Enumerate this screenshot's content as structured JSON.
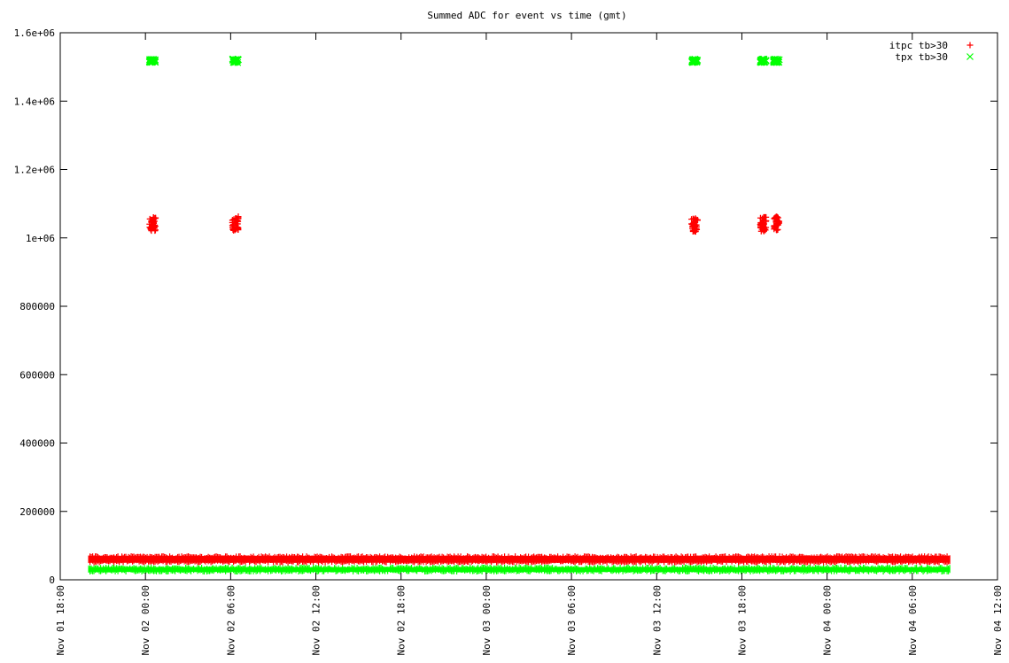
{
  "chart_data": {
    "type": "scatter",
    "title": "Summed ADC for event vs time (gmt)",
    "xlabel": "",
    "ylabel": "",
    "x_ticks": [
      "Nov 01 18:00",
      "Nov 02 00:00",
      "Nov 02 06:00",
      "Nov 02 12:00",
      "Nov 02 18:00",
      "Nov 03 00:00",
      "Nov 03 06:00",
      "Nov 03 12:00",
      "Nov 03 18:00",
      "Nov 04 00:00",
      "Nov 04 06:00",
      "Nov 04 12:00"
    ],
    "xlim": [
      "Nov 01 18:00",
      "Nov 04 12:00"
    ],
    "y_ticks": [
      "0",
      "200000",
      "400000",
      "600000",
      "800000",
      "1e+06",
      "1.2e+06",
      "1.4e+06",
      "1.6e+06"
    ],
    "ylim": [
      0,
      1600000
    ],
    "grid": false,
    "legend_position": "top-right",
    "series": [
      {
        "name": "itpc tb>30",
        "color": "#ff0000",
        "marker": "plus",
        "band": {
          "x_start": "Nov 01 20:00",
          "x_end": "Nov 04 08:40",
          "y_low": 45000,
          "y_high": 75000
        },
        "clusters": [
          {
            "x": "Nov 02 00:30",
            "y": 1040000
          },
          {
            "x": "Nov 02 06:20",
            "y": 1042000
          },
          {
            "x": "Nov 03 14:40",
            "y": 1038000
          },
          {
            "x": "Nov 03 19:30",
            "y": 1040000
          },
          {
            "x": "Nov 03 20:25",
            "y": 1042000
          }
        ]
      },
      {
        "name": "tpx tb>30",
        "color": "#00ff00",
        "marker": "cross",
        "band": {
          "x_start": "Nov 01 20:00",
          "x_end": "Nov 04 08:40",
          "y_low": 18000,
          "y_high": 42000
        },
        "clusters": [
          {
            "x": "Nov 02 00:30",
            "y": 1518000
          },
          {
            "x": "Nov 02 06:20",
            "y": 1518000
          },
          {
            "x": "Nov 03 14:40",
            "y": 1518000
          },
          {
            "x": "Nov 03 19:30",
            "y": 1518000
          },
          {
            "x": "Nov 03 20:25",
            "y": 1518000
          }
        ]
      }
    ]
  }
}
